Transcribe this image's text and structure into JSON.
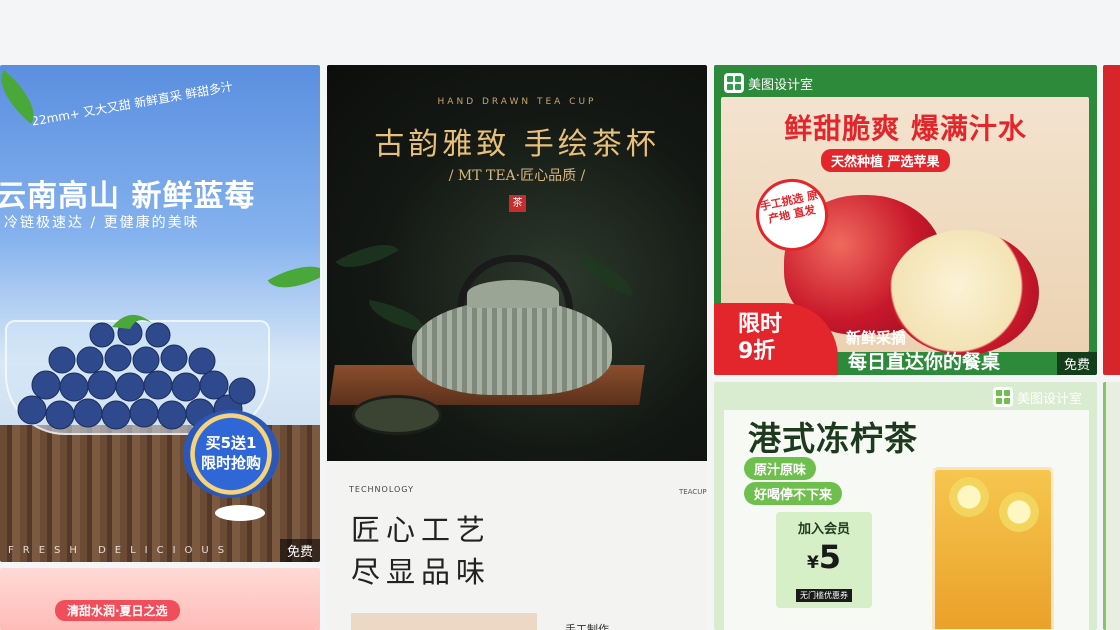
{
  "cards": {
    "blueberry": {
      "tagline": "22mm+ 又大又甜  新鲜直采  鲜甜多汁",
      "title": "云南高山 新鲜蓝莓",
      "subtitle": "冷链极速达 / 更健康的美味",
      "badge_line1": "买5送1",
      "badge_line2": "限时抢购",
      "footer_text": "FRESH DELICIOUS",
      "free_label": "免费"
    },
    "tea": {
      "en_title": "HAND DRAWN TEA CUP",
      "title": "古韵雅致 手绘茶杯",
      "brand_line": "/ MT TEA·匠心品质 /",
      "seal": "茶",
      "tech_label": "TECHNOLOGY",
      "craft_line1": "匠心工艺",
      "craft_line2": "尽显品味",
      "vertical_text": "TEACUP",
      "caption": "手工制作"
    },
    "apple": {
      "brand": "美图设计室",
      "title": "鲜甜脆爽 爆满汁水",
      "pill": "天然种植 严选苹果",
      "stamp": "手工挑选 原产地 直发",
      "promo_line1": "限时",
      "promo_line2": "9折",
      "fresh_label": "新鲜采摘",
      "daily_label": "每日直达你的餐桌",
      "free_label": "免费"
    },
    "lemon_tea": {
      "brand": "美图设计室",
      "title": "港式冻柠茶",
      "chip1": "原汁原味",
      "chip2": "好喝停不下来",
      "member_label": "加入会员",
      "price_symbol": "¥",
      "price": "5",
      "coupon": "无门槛优惠券"
    },
    "pink": {
      "pill": "清甜水润·夏日之选"
    }
  },
  "colors": {
    "apple_red": "#e3262b",
    "brand_green": "#2d8a3a",
    "tea_gold": "#e7c07a",
    "blue_sky": "#5a8fe0"
  }
}
